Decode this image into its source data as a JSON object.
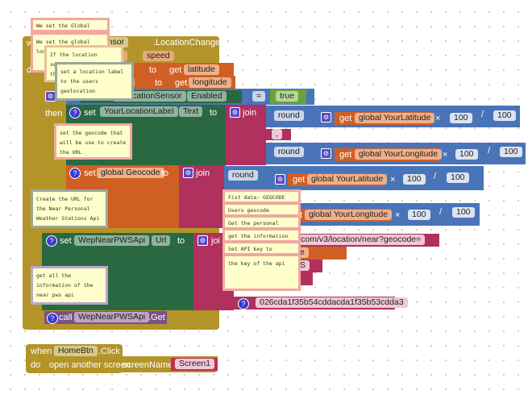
{
  "event": {
    "when": "w",
    "component": "nSensor",
    "event": ".LocationChanged",
    "params": [
      "ude",
      "speed"
    ],
    "do": "do"
  },
  "set_lat": {
    "name": "e",
    "to": "to",
    "get": "get",
    "var": "latitude"
  },
  "set_lon": {
    "name": "de",
    "to": "to",
    "get": "get",
    "var": "longitude"
  },
  "if_row": {
    "component": "wLocationSensor",
    "prop": "Enabled",
    "op": "=",
    "value": "true",
    "then": "then"
  },
  "set_label": {
    "set": "set",
    "component": "YourLocationLabel",
    "prop": "Text",
    "to": "to",
    "join": "join"
  },
  "round_lat": {
    "op": "round",
    "get": "get",
    "var": "global YourLatitude",
    "times": "×",
    "n1": "100",
    "div": "/",
    "n2": "100"
  },
  "comma": ",",
  "round_lon": {
    "op": "round",
    "get": "get",
    "var": "global YourLongitude",
    "times": "×",
    "n1": "100",
    "div": "/",
    "n2": "100"
  },
  "set_geocode": {
    "set": "set",
    "var": "global Geocode",
    "to": "to",
    "join": "join"
  },
  "round_lat2": {
    "op": "round",
    "get": "get",
    "var": "global YourLatitude",
    "times": "×",
    "n1": "100",
    "div": "/",
    "n2": "100"
  },
  "round_lon2": {
    "get": "t",
    "var": "global YourLongitude",
    "times": "×",
    "n1": "100",
    "div": "/",
    "n2": "100"
  },
  "set_url": {
    "set": "set",
    "component": "WepNearPWSApi",
    "prop": "Url",
    "to": "to",
    "join": "joi"
  },
  "url_strings": [
    "eather.com/v3/location/near?geocode=",
    "code",
    "VS",
    "",
    "026cda1f35b54cddacda1f35b53cdda3"
  ],
  "call": {
    "call": "call",
    "component": "WepNearPWSApi",
    "method": ".Get"
  },
  "home": {
    "when": "when",
    "component": "HomeBtn",
    "event": ".Click",
    "do": "do",
    "action": "open another screen",
    "param": "screenName",
    "value": "Screen1"
  },
  "comments": {
    "c1": "We set the Global Variable",
    "c2": "We set the global long... use...",
    "c3": "If the location sensor is true... the...",
    "c4": "set a location label to the users geolocation",
    "c5": "set the geocode that will be use to create the URL",
    "c6": "Create the URL for the Near Personal Weather Stations Api",
    "c7": "get all the information of the near pws api",
    "s1": "Fist data: GEOCODE",
    "s2": "Users geocode",
    "s3": "Get the personal weather",
    "s4": "get the information in a",
    "s5": "Set API key to",
    "s6": "the key of the api"
  }
}
